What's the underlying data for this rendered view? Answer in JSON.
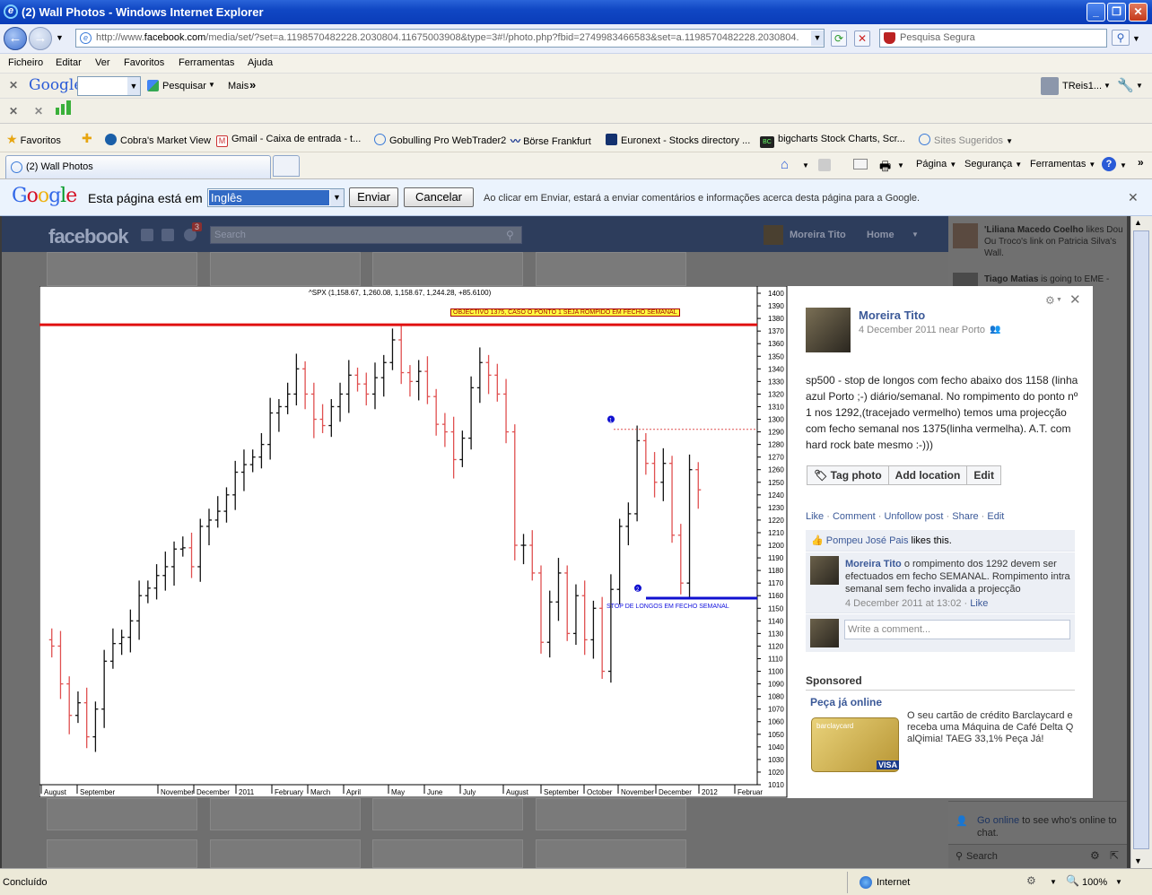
{
  "window": {
    "title": "(2) Wall Photos - Windows Internet Explorer",
    "url_prefix": "http://www.",
    "url_domain": "facebook.com",
    "url_rest": "/media/set/?set=a.1198570482228.2030804.11675003908&type=3#!/photo.php?fbid=2749983466583&set=a.1198570482228.2030804.",
    "search_placeholder": "Pesquisa Segura"
  },
  "menu": [
    "Ficheiro",
    "Editar",
    "Ver",
    "Favoritos",
    "Ferramentas",
    "Ajuda"
  ],
  "google_toolbar": {
    "logo": "Google",
    "search_label": "Pesquisar",
    "more_label": "Mais",
    "user_label": "TReis1..."
  },
  "favorites": {
    "label": "Favoritos",
    "items": [
      "Cobra's Market View",
      "Gmail - Caixa de entrada - t...",
      "Gobulling Pro WebTrader2",
      "Börse Frankfurt",
      "Euronext - Stocks directory ...",
      "bigcharts Stock Charts, Scr...",
      "Sites Sugeridos"
    ]
  },
  "tab": {
    "label": "(2) Wall Photos"
  },
  "commands": [
    "Página",
    "Segurança",
    "Ferramentas"
  ],
  "translate": {
    "logo": "Google",
    "text": "Esta página está em",
    "language": "Inglês",
    "send": "Enviar",
    "cancel": "Cancelar",
    "notice": "Ao clicar em Enviar, estará a enviar comentários e informações acerca desta página para a Google."
  },
  "facebook": {
    "logo": "facebook",
    "search_placeholder": "Search",
    "user_name": "Moreira Tito",
    "home": "Home",
    "notification_count": "3"
  },
  "ticker": [
    {
      "name": "'Liliana Macedo Coelho",
      "text": "likes Dou Ou Troco's link on Patricia Silva's Wall."
    },
    {
      "name": "Tiago Matias",
      "text": "is going to EME -"
    }
  ],
  "chat": {
    "text_link": "Go online",
    "text": "to see who's online to chat.",
    "search": "Search"
  },
  "photo": {
    "author": "Moreira Tito",
    "date": "4 December 2011 near Porto",
    "caption": "sp500 - stop de longos com fecho abaixo dos 1158 (linha azul Porto ;-) diário/semanal. No rompimento do ponto nº 1 nos 1292,(tracejado vermelho) temos uma projecção com fecho semanal nos 1375(linha vermelha). A.T. com hard rock bate mesmo :-)))",
    "buttons": [
      "Tag photo",
      "Add location",
      "Edit"
    ],
    "actions": [
      "Like",
      "Comment",
      "Unfollow post",
      "Share",
      "Edit"
    ],
    "likes_name": "Pompeu José Pais",
    "likes_text": "likes this.",
    "comment_author": "Moreira Tito",
    "comment_text": "o rompimento dos 1292 devem ser efectuados em fecho SEMANAL. Rompimento intra semanal sem fecho invalida a projecção",
    "comment_date": "4 December 2011 at 13:02",
    "comment_like": "Like",
    "write_placeholder": "Write a comment...",
    "sponsored": "Sponsored",
    "ad_title": "Peça já online",
    "ad_text": "O seu cartão de crédito Barclaycard e receba uma Máquina de Café Delta Q alQimia! TAEG 33,1% Peça Já!",
    "ad_card_brand": "barclaycard",
    "ad_card_logo": "VISA"
  },
  "status": {
    "left": "Concluído",
    "zone": "Internet",
    "zoom": "100%"
  },
  "chart_data": {
    "type": "ohlc",
    "title": "^SPX (1,158.67, 1,260.08, 1,158.67, 1,244.28, +85.6100)",
    "annotation_top": "OBJECTIVO 1375, CASO O PONTO 1 SEJA ROMPIDO EM FECHO SEMANAL",
    "annotation_bottom": "STOP DE LONGOS EM FECHO SEMANAL",
    "point1_label": "1",
    "point2_label": "2",
    "ylim": [
      1010,
      1400
    ],
    "y_ticks": [
      1400,
      1390,
      1380,
      1370,
      1360,
      1350,
      1340,
      1330,
      1320,
      1310,
      1300,
      1290,
      1280,
      1270,
      1260,
      1250,
      1240,
      1230,
      1220,
      1210,
      1200,
      1190,
      1180,
      1170,
      1160,
      1150,
      1140,
      1130,
      1120,
      1110,
      1100,
      1090,
      1080,
      1070,
      1060,
      1050,
      1040,
      1030,
      1020,
      1010
    ],
    "x_labels": [
      "August",
      "September",
      "November",
      "December",
      "2011",
      "February",
      "March",
      "April",
      "May",
      "June",
      "July",
      "August",
      "September",
      "October",
      "November",
      "December",
      "2012",
      "Februar"
    ],
    "lines": {
      "target": 1375,
      "breakout": 1292,
      "stop": 1158
    },
    "bars_summary": "weekly OHLC, Aug 2010 - Dec 2011"
  }
}
